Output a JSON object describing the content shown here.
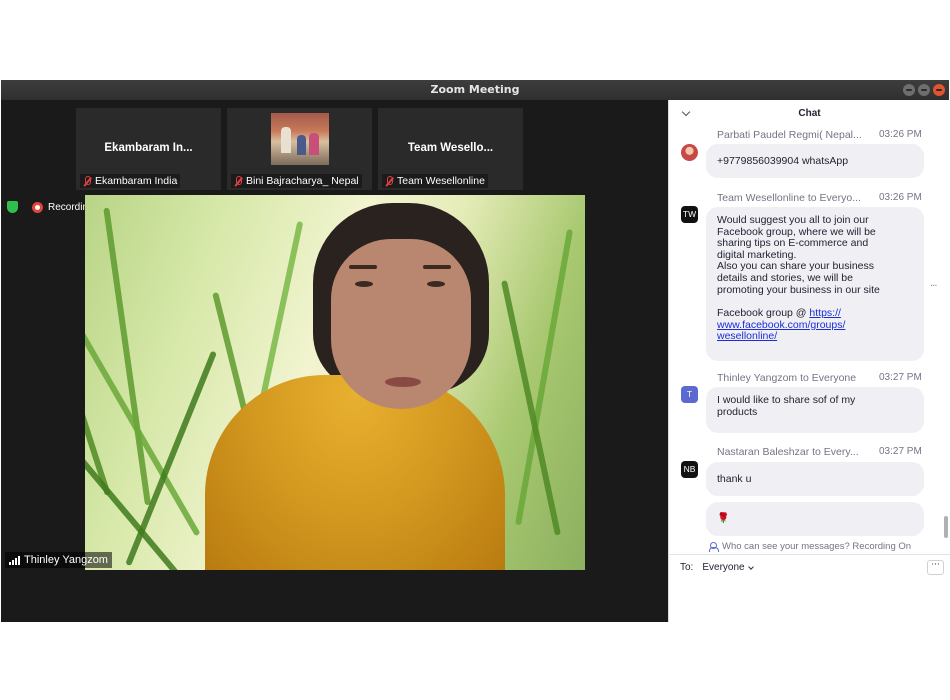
{
  "window": {
    "title": "Zoom Meeting"
  },
  "thumbnails": [
    {
      "title": "Ekambaram In...",
      "name": "Ekambaram India"
    },
    {
      "title": "",
      "name": "Bini Bajracharya_ Nepal"
    },
    {
      "title": "Team Wesello...",
      "name": "Team Wesellonline"
    }
  ],
  "status": {
    "recording_label": "Recording"
  },
  "main_video": {
    "participant_name": "Thinley Yangzom"
  },
  "chat": {
    "title": "Chat",
    "messages": [
      {
        "sender": "Parbati Paudel Regmi( Nepal...",
        "time": "03:26 PM",
        "text": "+9779856039904 whatsApp"
      },
      {
        "sender": "Team Wesellonline to Everyo...",
        "time": "03:26 PM",
        "avatar": "TW",
        "lines": [
          "Would suggest you all to join our",
          "Facebook group, where we will be",
          "sharing tips on E-commerce and",
          "digital marketing.",
          "Also you can share your business",
          "details and stories, we will be",
          "promoting your business in our site"
        ],
        "link_prefix": "Facebook group @ ",
        "link_lines": [
          "https://",
          "www.facebook.com/groups/",
          "wesellonline/"
        ]
      },
      {
        "sender": "Thinley Yangzom to Everyone",
        "time": "03:27 PM",
        "avatar": "T",
        "lines": [
          "I would like to share sof of my",
          "products"
        ]
      },
      {
        "sender": "Nastaran Baleshzar to Every...",
        "time": "03:27 PM",
        "avatar": "NB",
        "text": "thank u",
        "emoji": "🌹"
      }
    ],
    "privacy_text": "Who can see your messages? Recording On",
    "to_label": "To:",
    "to_value": "Everyone",
    "more_label": "···"
  },
  "colors": {
    "titlebar": "#2f2f2f",
    "video_bg": "#1a1a1a",
    "bubble": "#efeff4",
    "link": "#1a2dd8",
    "muted_mic": "#e04040",
    "recording": "#e0443a",
    "shield": "#2fbf4f"
  },
  "icons": [
    "chevron-down-icon",
    "mic-muted-icon",
    "shield-icon",
    "record-icon",
    "signal-icon",
    "people-icon",
    "more-icon",
    "rose-emoji"
  ]
}
